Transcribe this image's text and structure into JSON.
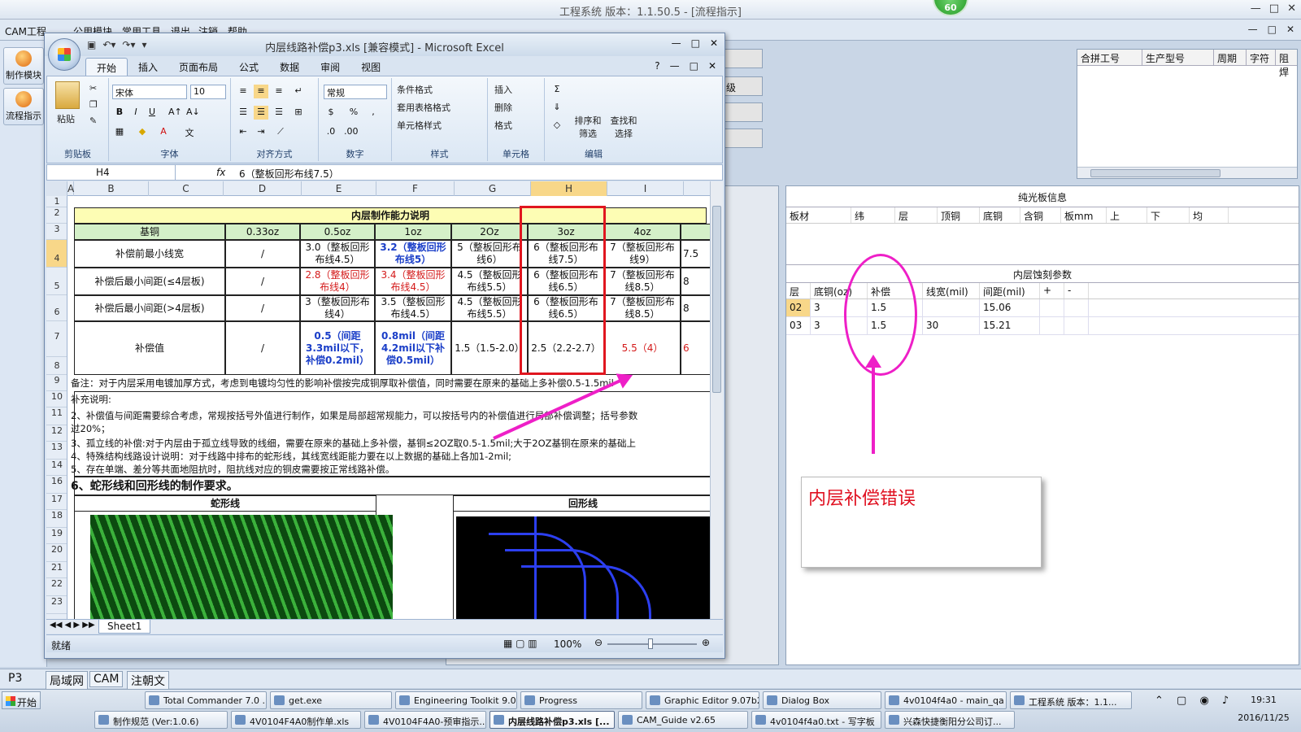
{
  "app": {
    "title": "工程系统   版本：1.1.50.5 - [流程指示]",
    "badge": "60",
    "menu": [
      "CAM工程",
      "公用模块",
      "常用工具",
      "退出",
      "注销",
      "帮助"
    ],
    "nav": [
      "制作模块",
      "流程指示"
    ],
    "stub_label": "级",
    "win_controls": [
      "—",
      "□",
      "✕"
    ]
  },
  "right_top_table": {
    "headers": [
      "合拼工号",
      "生产型号",
      "周期",
      "字符",
      "阻焊"
    ]
  },
  "right_panel": {
    "section1_title": "纯光板信息",
    "section1_headers": [
      "板材",
      "纬",
      "层",
      "顶铜",
      "底铜",
      "含铜",
      "板mm",
      "上",
      "下",
      "均"
    ],
    "section2_title": "内层蚀刻参数",
    "section2_headers": [
      "层",
      "底铜(oz)",
      "补偿",
      "线宽(mil)",
      "间距(mil)",
      "+",
      "-"
    ],
    "section2_rows": [
      [
        "02",
        "3",
        "1.5",
        "",
        "15.06",
        "",
        ""
      ],
      [
        "03",
        "3",
        "1.5",
        "30",
        "15.21",
        "",
        ""
      ]
    ]
  },
  "callout": {
    "text": "内层补偿错误"
  },
  "app_tabs": [
    "P3",
    "局域网",
    "CAM",
    "注朝文"
  ],
  "taskbar": {
    "start": "开始",
    "row1": [
      "Total Commander 7.0 ...",
      "get.exe",
      "Engineering Toolkit 9.0...",
      "Progress",
      "Graphic Editor 9.07b2 ...",
      "Dialog Box",
      "4v0104f4a0 - main_qa",
      "工程系统 版本：1.1..."
    ],
    "row2": [
      "制作规范 (Ver:1.0.6)",
      "4V0104F4A0制作单.xls",
      "4V0104F4A0-预审指示....",
      "内层线路补偿p3.xls [...",
      "CAM_Guide v2.65",
      "4v0104f4a0.txt - 写字板",
      "兴森快捷衡阳分公司订..."
    ],
    "time": "19:31",
    "date": "2016/11/25"
  },
  "excel": {
    "title": "内层线路补偿p3.xls [兼容模式] - Microsoft Excel",
    "tabs": [
      "开始",
      "插入",
      "页面布局",
      "公式",
      "数据",
      "审阅",
      "视图"
    ],
    "groups": [
      "剪贴板",
      "字体",
      "对齐方式",
      "数字",
      "样式",
      "单元格",
      "编辑"
    ],
    "paste_label": "粘贴",
    "font_name": "宋体",
    "font_size": "10",
    "number_format": "常规",
    "style_items": [
      "条件格式",
      "套用表格格式",
      "单元格样式"
    ],
    "cell_items": [
      "插入",
      "删除",
      "格式"
    ],
    "edit_items": [
      "排序和筛选",
      "查找和选择"
    ],
    "name_box": "H4",
    "formula": "6（整板回形布线7.5）",
    "columns": [
      "A",
      "B",
      "C",
      "D",
      "E",
      "F",
      "G",
      "H",
      "I"
    ],
    "rows": [
      "1",
      "2",
      "3",
      "4",
      "5",
      "6",
      "7",
      "8",
      "9",
      "10",
      "11",
      "12",
      "13",
      "14",
      "16",
      "17",
      "18",
      "19",
      "20",
      "21",
      "22",
      "23"
    ],
    "sheet_tab": "Sheet1",
    "status": "就绪",
    "zoom": "100%",
    "table": {
      "title": "内层制作能力说明",
      "headers": [
        "基铜",
        "0.33oz",
        "0.5oz",
        "1oz",
        "2Oz",
        "3oz",
        "4oz"
      ],
      "rows": [
        {
          "label": "补偿前最小线宽",
          "cells": [
            "/",
            "3.0（整板回形布线4.5）",
            "3.2（整板回形布线5）",
            "5（整板回形布线6）",
            "6（整板回形布线7.5）",
            "7（整板回形布线9）"
          ]
        },
        {
          "label": "补偿后最小间距(≤4层板)",
          "cells": [
            "/",
            "2.8（整板回形布线4）",
            "3.4（整板回形布线4.5）",
            "4.5（整板回形布线5.5）",
            "6（整板回形布线6.5）",
            "7（整板回形布线8.5）"
          ]
        },
        {
          "label": "补偿后最小间距(>4层板)",
          "cells": [
            "/",
            "3（整板回形布线4）",
            "3.5（整板回形布线4.5）",
            "4.5（整板回形布线5.5）",
            "6（整板回形布线6.5）",
            "7（整板回形布线8.5）"
          ]
        },
        {
          "label": "补偿值",
          "cells": [
            "/",
            "0.5（间距3.3mil以下，补偿0.2mil）",
            "0.8mil（间距4.2mil以下补偿0.5mil）",
            "1.5（1.5-2.0）",
            "2.5（2.2-2.7）",
            "5.5（4）"
          ]
        }
      ],
      "overflow": [
        "7.5",
        "8",
        "8",
        "6"
      ],
      "note9": "备注：对于内层采用电镀加厚方式，考虑到电镀均匀性的影响补偿按完成铜厚取补偿值，同时需要在原来的基础上多补偿0.5-1.5mil",
      "notes": [
        "补充说明:",
        "2、补偿值与间距需要综合考虑，常规按括号外值进行制作，如果是局部超常规能力，可以按括号内的补偿值进行局部补偿调整；括号参数",
        "过20%；",
        "3、孤立线的补偿:对于内层由于孤立线导致的线细，需要在原来的基础上多补偿，基铜≤2OZ取0.5-1.5mil;大于2OZ基铜在原来的基础上",
        "4、特殊结构线路设计说明：对于线路中排布的蛇形线，其线宽线距能力要在以上数据的基础上各加1-2mil;",
        "5、存在单端、差分等共面地阻抗时，阻抗线对应的铜皮需要按正常线路补偿。"
      ],
      "section6": "6、蛇形线和回形线的制作要求。",
      "snake": "蛇形线",
      "loop": "回形线"
    }
  }
}
